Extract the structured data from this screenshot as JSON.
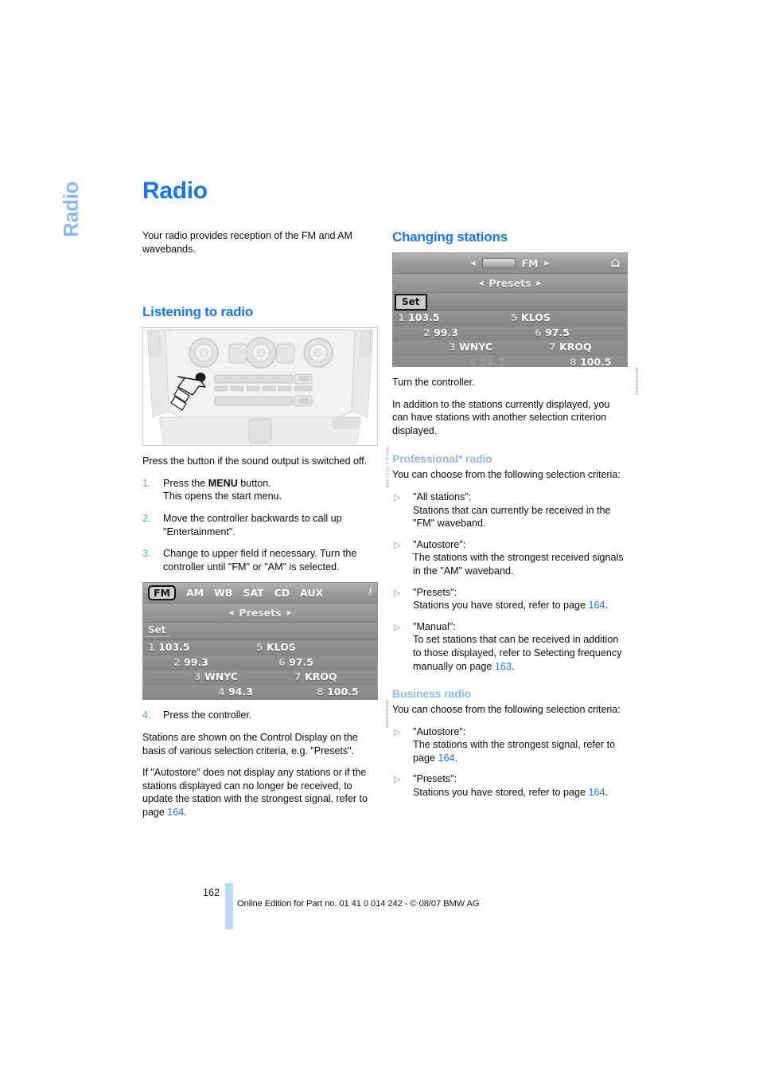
{
  "chapter_tab": {
    "label": "Radio"
  },
  "page_title": "Radio",
  "left_column": {
    "intro": "Your radio provides reception of the FM and AM wavebands.",
    "section_heading": "Listening to radio",
    "figure_dashboard": {
      "id_code": "BMW 7 E 65 / E 66 Radio"
    },
    "after_figure": "Press the button if the sound output is switched off.",
    "steps": [
      {
        "num": "1.",
        "text_before": "Press the ",
        "bold": "MENU",
        "text_after": " button.",
        "line2": "This opens the start menu."
      },
      {
        "num": "2.",
        "text": "Move the controller backwards to call up \"Entertainment\"."
      },
      {
        "num": "3.",
        "text": "Change to upper field if necessary. Turn the controller until \"FM\" or \"AM\" is selected."
      }
    ],
    "figure_presets": {
      "id_code": "BMW0000000GB",
      "tabs": [
        "FM",
        "AM",
        "WB",
        "SAT",
        "CD",
        "AUX"
      ],
      "selected_tab": "FM",
      "lock_icon": "lock-icon",
      "presets_label": "Presets",
      "set_label": "Set",
      "presets": [
        {
          "index": "1",
          "value": "103.5",
          "col": "left"
        },
        {
          "index": "5",
          "value": "KLOS",
          "col": "right"
        },
        {
          "index": "2",
          "value": "99.3",
          "col": "left"
        },
        {
          "index": "6",
          "value": "97.5",
          "col": "right"
        },
        {
          "index": "3",
          "value": "WNYC",
          "col": "left"
        },
        {
          "index": "7",
          "value": "KROQ",
          "col": "right"
        },
        {
          "index": "4",
          "value": "94.3",
          "col": "left"
        },
        {
          "index": "8",
          "value": "100.5",
          "col": "right"
        }
      ]
    },
    "step4": {
      "num": "4.",
      "text": "Press the controller."
    },
    "para_after_step4": "Stations are shown on the Control Display on the basis of various selection criteria, e.g. \"Presets\".",
    "para_autostore_a": "If \"Autostore\" does not display any stations or if the stations displayed can no longer be received, to update the station with the strongest signal, refer to page ",
    "para_autostore_ref": "164",
    "para_autostore_b": "."
  },
  "right_column": {
    "section_heading": "Changing stations",
    "figure_changing": {
      "id_code": "BMW0000000GB",
      "band_label": "FM",
      "home_icon": "home-icon",
      "presets_label": "Presets",
      "set_label": "Set",
      "presets": [
        {
          "index": "1",
          "value": "103.5",
          "col": "left",
          "dim": false
        },
        {
          "index": "5",
          "value": "KLOS",
          "col": "right",
          "dim": false
        },
        {
          "index": "2",
          "value": "99.3",
          "col": "left",
          "dim": false
        },
        {
          "index": "6",
          "value": "97.5",
          "col": "right",
          "dim": false
        },
        {
          "index": "3",
          "value": "WNYC",
          "col": "left",
          "dim": false
        },
        {
          "index": "7",
          "value": "KROQ",
          "col": "right",
          "dim": false
        },
        {
          "index": "4",
          "value": "94.3",
          "col": "left",
          "dim": true
        },
        {
          "index": "8",
          "value": "100.5",
          "col": "right",
          "dim": false
        }
      ]
    },
    "turn_controller": "Turn the controller.",
    "in_addition": "In addition to the stations currently displayed, you can have stations with another selection criterion displayed.",
    "professional": {
      "heading": "Professional* radio",
      "intro": "You can choose from the following selection criteria:",
      "items": [
        {
          "title": "\"All stations\":",
          "body": "Stations that can currently be received in the \"FM\" waveband."
        },
        {
          "title": "\"Autostore\":",
          "body": "The stations with the strongest received signals in the \"AM\" waveband."
        },
        {
          "title": "\"Presets\":",
          "body_before": "Stations you have stored, refer to page ",
          "ref": "164",
          "body_after": "."
        },
        {
          "title": "\"Manual\":",
          "body_before": "To set stations that can be received in addition to those displayed, refer to Selecting frequency manually on page ",
          "ref": "163",
          "body_after": "."
        }
      ]
    },
    "business": {
      "heading": "Business radio",
      "intro": "You can choose from the following selection criteria:",
      "items": [
        {
          "title": "\"Autostore\":",
          "body_before": "The stations with the strongest signal, refer to page ",
          "ref": "164",
          "body_after": "."
        },
        {
          "title": "\"Presets\":",
          "body_before": "Stations you have stored, refer to page ",
          "ref": "164",
          "body_after": "."
        }
      ]
    }
  },
  "footer": {
    "page_number": "162",
    "imprint": "Online Edition for Part no. 01 41 0 014 242 - © 08/07 BMW AG"
  },
  "colors": {
    "heading_blue": "#1677EE",
    "subheading_blue": "#8DB9F2",
    "link_blue": "#1677EE",
    "margin_bar": "#BDD7F7"
  }
}
